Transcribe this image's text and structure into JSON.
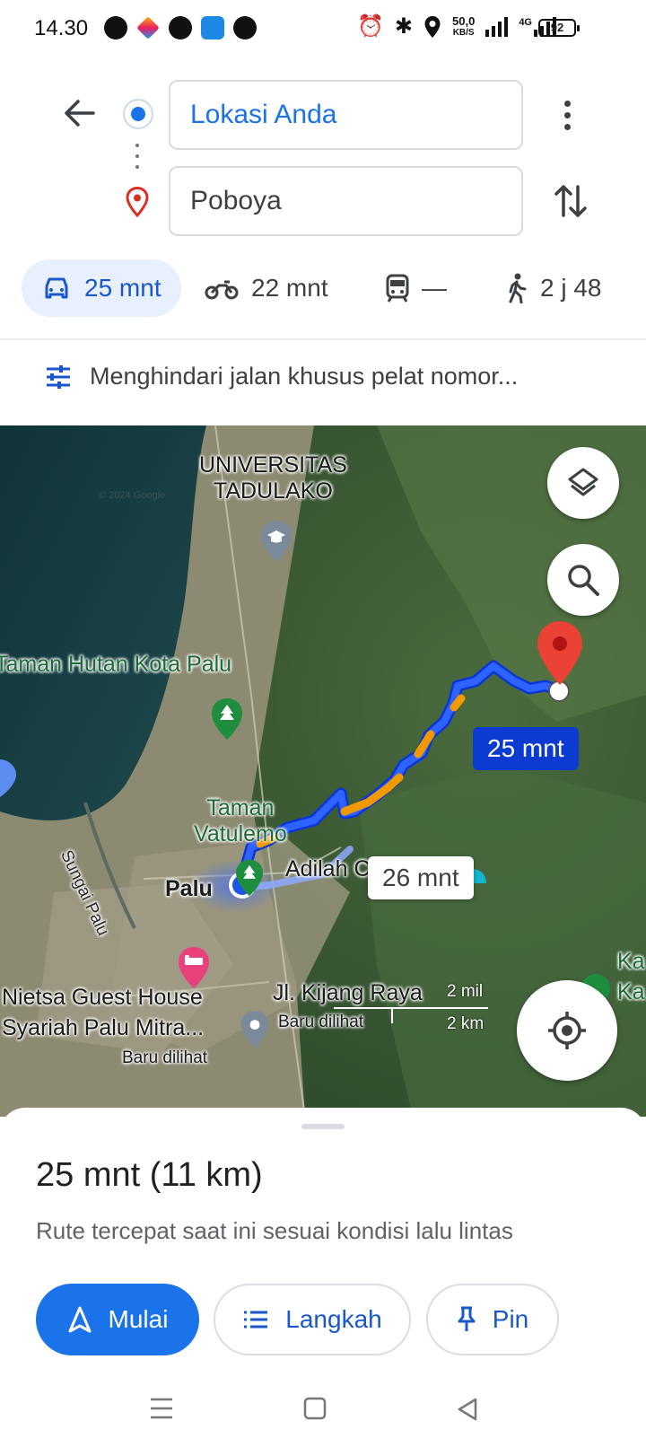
{
  "status_bar": {
    "time": "14.30",
    "net_speed_value": "50,0",
    "net_speed_unit": "KB/S",
    "network": "4G",
    "battery": "92"
  },
  "directions": {
    "origin": "Lokasi Anda",
    "destination": "Poboya"
  },
  "modes": {
    "car": "25 mnt",
    "motorcycle": "22 mnt",
    "transit": "—",
    "walk": "2 j 48"
  },
  "options_text": "Menghindari jalan khusus pelat nomor...",
  "map": {
    "labels": {
      "university": "UNIVERSITAS\nTADULAKO",
      "park1": "Taman Hutan Kota Palu",
      "park2": "Taman\nVatulemo",
      "river": "Sungai Palu",
      "city": "Palu",
      "place_adilah": "Adilah C",
      "guesthouse": "Nietsa Guest House\nSyariah Palu Mitra...",
      "guesthouse_note": "Baru dilihat",
      "road": "Jl. Kijang Raya",
      "road_note": "Baru dilihat",
      "edge_label": "Ka\nKa",
      "watermark": "© 2024 Google"
    },
    "route_primary": "25 mnt",
    "route_alt": "26 mnt",
    "scale_mi": "2 mil",
    "scale_km": "2 km"
  },
  "sheet": {
    "summary": "25 mnt (11 km)",
    "note": "Rute tercepat saat ini sesuai kondisi lalu lintas",
    "start": "Mulai",
    "steps": "Langkah",
    "pin": "Pin"
  },
  "colors": {
    "accent": "#1a73e8",
    "route": "#1d4fe8",
    "traffic": "#f29900",
    "destination": "#d93025"
  }
}
